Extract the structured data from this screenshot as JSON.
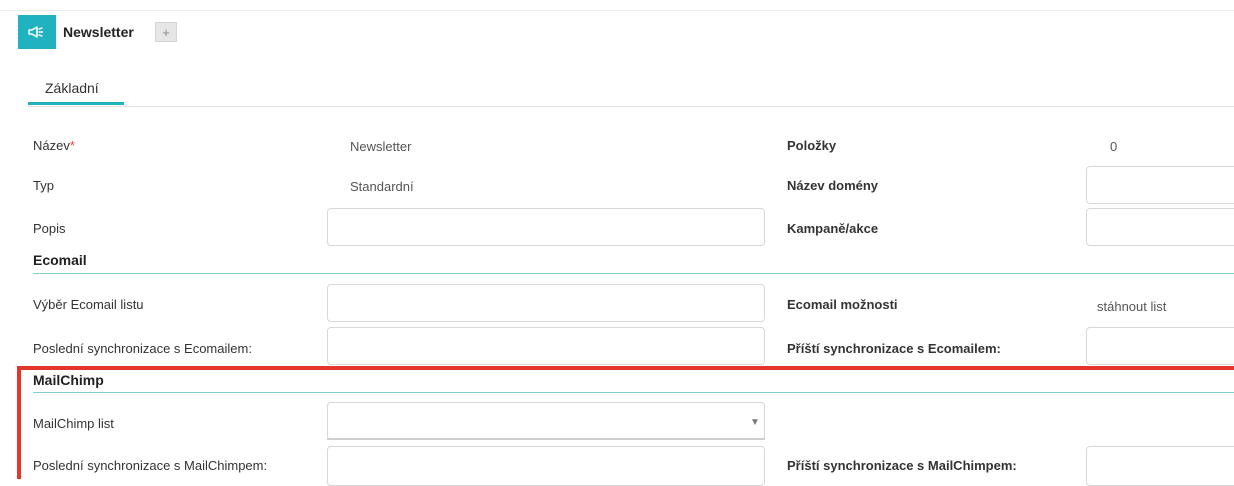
{
  "header": {
    "title": "Newsletter",
    "add_label": "+",
    "module_icon": "megaphone-icon"
  },
  "tabs": [
    {
      "label": "Základní",
      "active": true
    }
  ],
  "fields": {
    "nazev": {
      "label": "Název",
      "required_mark": "*",
      "value": "Newsletter"
    },
    "typ": {
      "label": "Typ",
      "value": "Standardní"
    },
    "popis": {
      "label": "Popis",
      "value": ""
    },
    "polozky": {
      "label": "Položky",
      "value": "0"
    },
    "nazev_domeny": {
      "label": "Název domény",
      "value": ""
    },
    "kampane": {
      "label": "Kampaně/akce",
      "value": ""
    }
  },
  "ecomail": {
    "title": "Ecomail",
    "vyber_listu": {
      "label": "Výběr Ecomail listu",
      "value": ""
    },
    "posledni_sync": {
      "label": "Poslední synchronizace s Ecomailem:",
      "value": ""
    },
    "moznosti": {
      "label": "Ecomail možnosti",
      "value": "stáhnout list"
    },
    "pristi_sync": {
      "label": "Příští synchronizace s Ecomailem:",
      "value": ""
    }
  },
  "mailchimp": {
    "title": "MailChimp",
    "list": {
      "label": "MailChimp list",
      "value": ""
    },
    "posledni_sync": {
      "label": "Poslední synchronizace s MailChimpem:",
      "value": ""
    },
    "pristi_sync": {
      "label": "Příští synchronizace s MailChimpem:",
      "value": ""
    }
  },
  "colors": {
    "accent": "#20b3bf",
    "highlight": "#e5342a",
    "required": "#e0463d"
  }
}
